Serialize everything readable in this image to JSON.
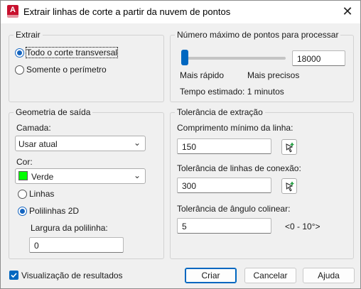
{
  "window": {
    "title": "Extrair linhas de corte a partir da nuvem de pontos",
    "app_icon_letter": "A",
    "close_glyph": "✕"
  },
  "extrair": {
    "title": "Extrair",
    "options": [
      {
        "label": "Todo o corte transversal",
        "selected": true
      },
      {
        "label": "Somente o perímetro",
        "selected": false
      }
    ]
  },
  "max_points": {
    "title": "Número máximo de pontos para processar",
    "value": "18000",
    "slider_level": 0.03,
    "label_fast": "Mais rápido",
    "label_precise": "Mais precisos",
    "estimated_time": "Tempo estimado: 1 minutos"
  },
  "output_geometry": {
    "title": "Geometria de saída",
    "layer_label": "Camada:",
    "layer_value": "Usar atual",
    "color_label": "Cor:",
    "color_value": "Verde",
    "color_swatch": "#00ff00",
    "options": [
      {
        "label": "Linhas",
        "selected": false
      },
      {
        "label": "Polilinhas 2D",
        "selected": true
      }
    ],
    "polyline_width_label": "Largura da polilinha:",
    "polyline_width_value": "0"
  },
  "tolerance": {
    "title": "Tolerância de extração",
    "min_length_label": "Comprimento mínimo da linha:",
    "min_length_value": "150",
    "connection_label": "Tolerância de linhas de conexão:",
    "connection_value": "300",
    "collinear_label": "Tolerância de ângulo colinear:",
    "collinear_value": "5",
    "collinear_range": "<0 - 10°>"
  },
  "footer": {
    "preview_label": "Visualização de resultados",
    "preview_checked": true,
    "create_label": "Criar",
    "cancel_label": "Cancelar",
    "help_label": "Ajuda"
  },
  "colors": {
    "accent": "#0067c0",
    "app_icon": "#c8102e"
  }
}
